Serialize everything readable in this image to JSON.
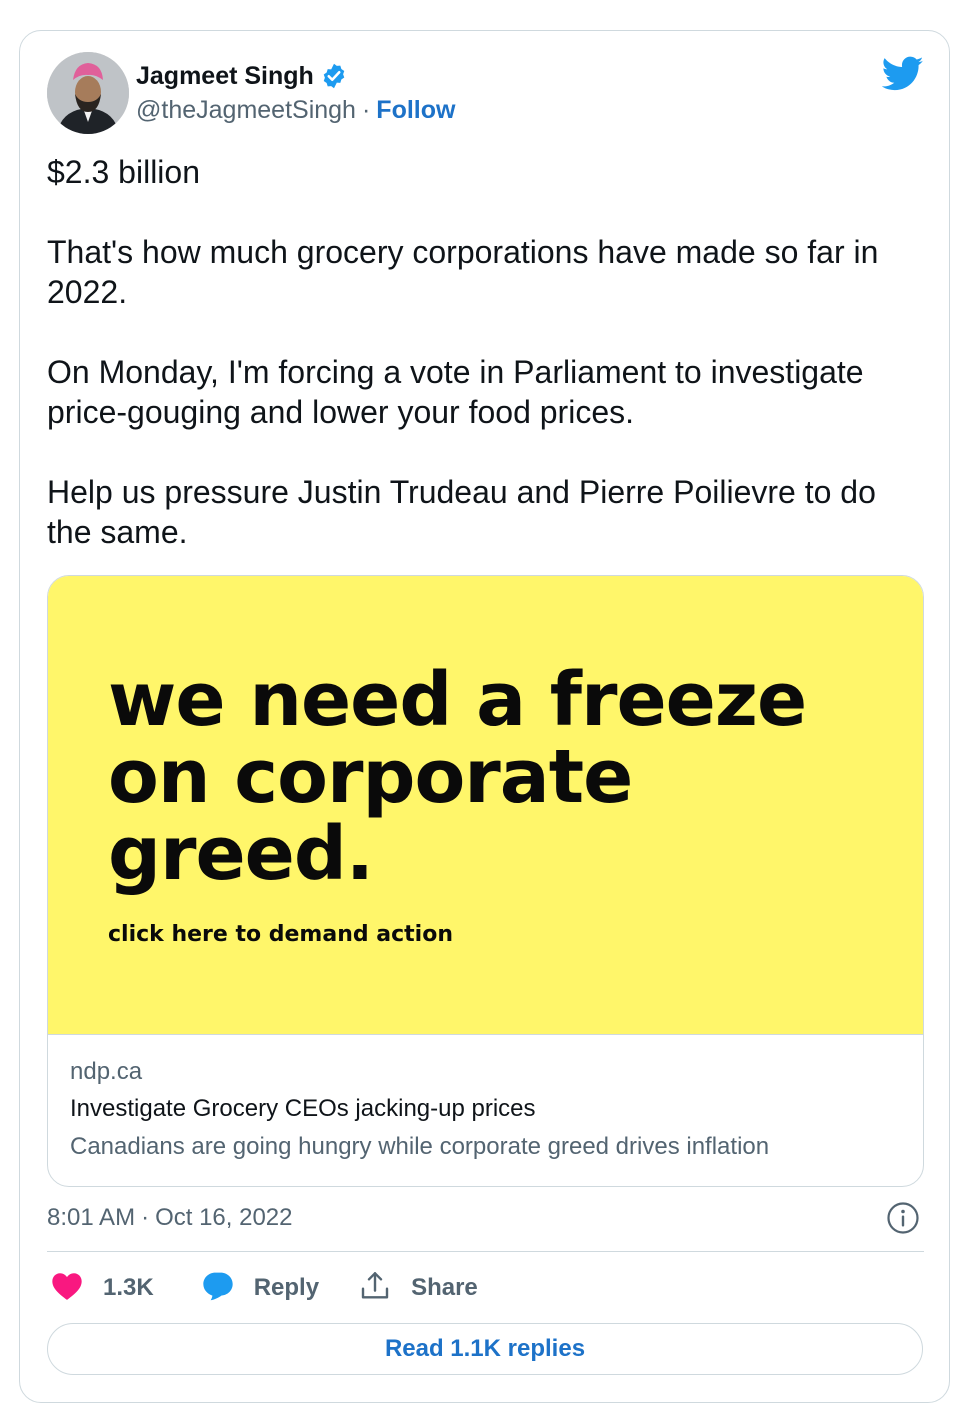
{
  "author": {
    "name": "Jagmeet Singh",
    "handle": "@theJagmeetSingh",
    "separator": "·",
    "follow_label": "Follow",
    "avatar_icon": "profile-photo",
    "verified_icon": "verified-badge-icon",
    "brand_icon": "twitter-bird-icon"
  },
  "tweet": {
    "paragraphs": [
      "$2.3 billion",
      "That's how much grocery corporations have made so far in 2022.",
      "On Monday, I'm forcing a vote in Parliament to investigate price-gouging and lower your food prices.",
      "Help us pressure Justin Trudeau and Pierre Poilievre to do the same."
    ]
  },
  "link_card": {
    "image_headline": "we need a freeze on corporate greed.",
    "image_cta": "click here to demand action",
    "domain": "ndp.ca",
    "title": "Investigate Grocery CEOs jacking-up prices",
    "description": "Canadians are going hungry while corporate greed drives inflation"
  },
  "meta": {
    "time": "8:01 AM",
    "separator": "·",
    "date": "Oct 16, 2022",
    "info_icon": "info-icon"
  },
  "actions": {
    "like_count": "1.3K",
    "reply_label": "Reply",
    "share_label": "Share"
  },
  "read_replies_label": "Read 1.1K replies",
  "colors": {
    "accent": "#1d72c8",
    "twitter_blue": "#1d9bf0",
    "like_pink": "#f91880",
    "card_yellow": "#fff66a",
    "border": "#cfd9de",
    "muted": "#536471"
  }
}
